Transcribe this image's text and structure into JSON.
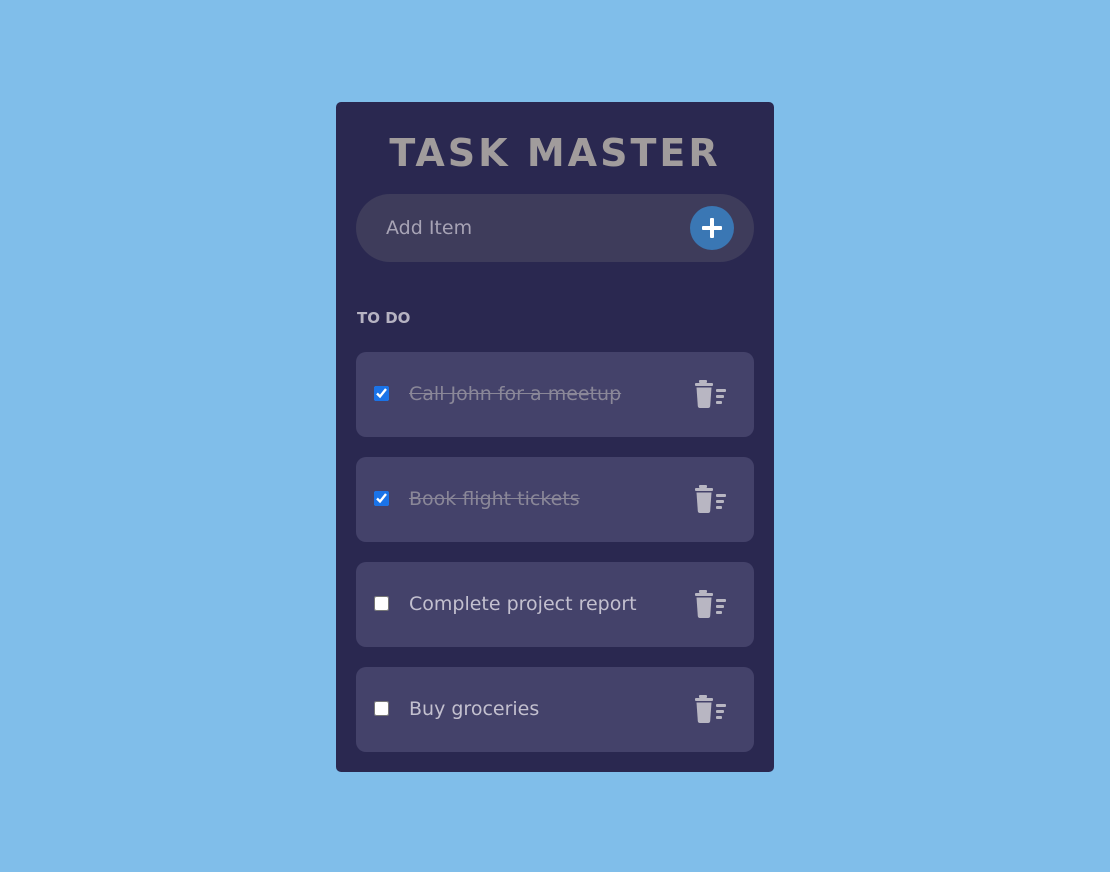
{
  "app": {
    "title": "TASK MASTER"
  },
  "add_item": {
    "placeholder": "Add Item",
    "button_icon": "plus-icon"
  },
  "section": {
    "label": "TO DO"
  },
  "tasks": [
    {
      "text": "Call John for a meetup",
      "checked": true
    },
    {
      "text": "Book flight tickets",
      "checked": true
    },
    {
      "text": "Complete project report",
      "checked": false
    },
    {
      "text": "Buy groceries",
      "checked": false
    }
  ],
  "icons": {
    "delete": "trash-list-icon",
    "add": "plus-icon"
  },
  "colors": {
    "background": "#80beea",
    "card": "#2a2850",
    "row": "#44426a",
    "accent": "#3a77b4",
    "title": "#a19c9c"
  }
}
